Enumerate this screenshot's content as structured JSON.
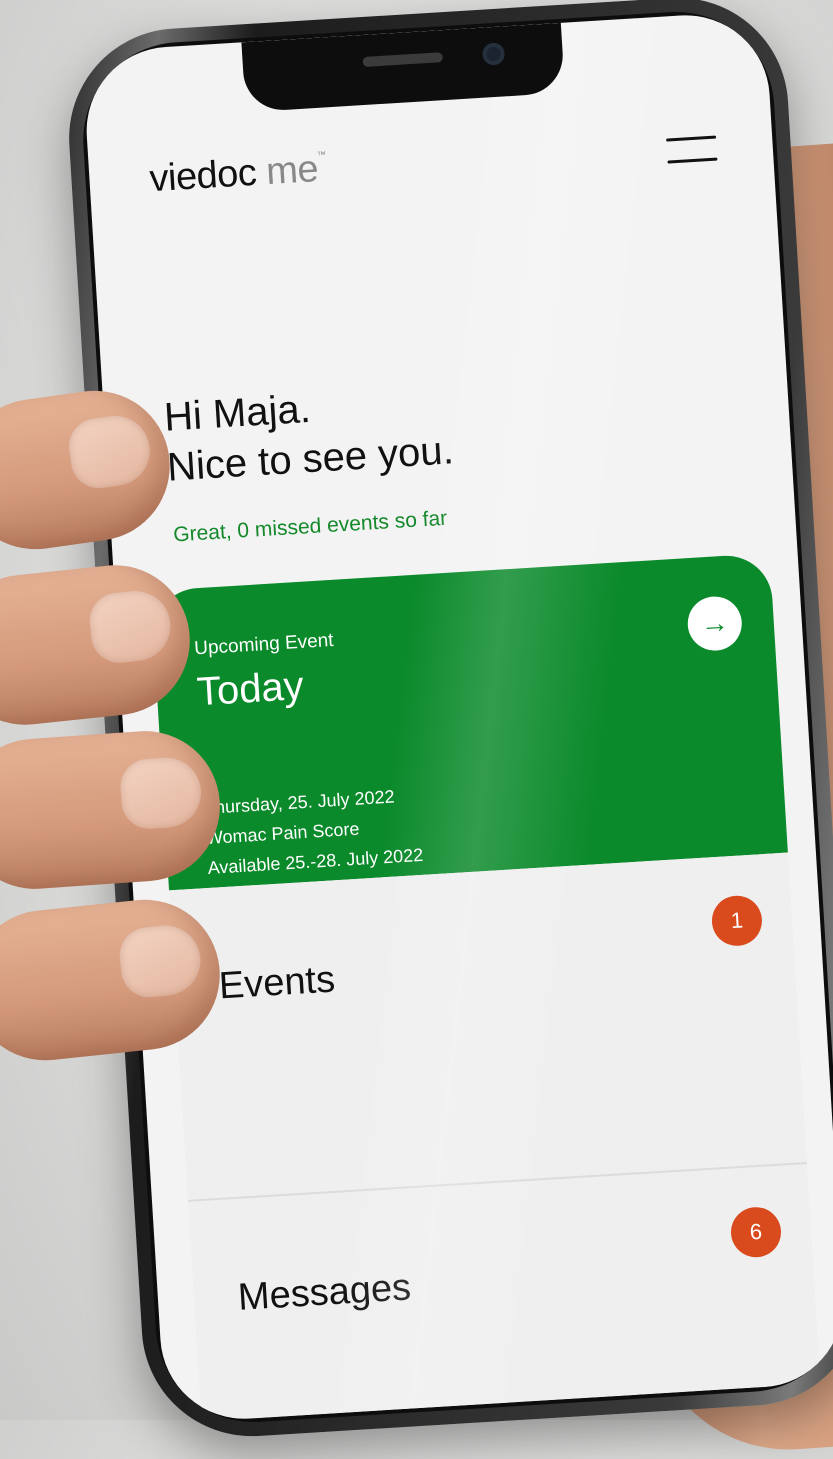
{
  "app": {
    "logo_main": "viedoc",
    "logo_sub": "me",
    "logo_tm": "™"
  },
  "header": {
    "menu_icon": "hamburger-menu-icon"
  },
  "greeting": {
    "line1": "Hi Maja.",
    "line2": "Nice to see you."
  },
  "status": {
    "missed_text": "Great, 0 missed events so far",
    "color": "#14892b"
  },
  "upcoming": {
    "label": "Upcoming Event",
    "when": "Today",
    "date": "Thursday, 25. July 2022",
    "form": "Womac Pain Score",
    "availability": "Available 25.-28. July 2022",
    "arrow_icon": "arrow-right-icon",
    "color": "#0b8a2b"
  },
  "sections": {
    "events": {
      "title": "Events",
      "badge": "1"
    },
    "messages": {
      "title": "Messages",
      "badge": "6"
    }
  },
  "colors": {
    "badge": "#d94a1c"
  }
}
